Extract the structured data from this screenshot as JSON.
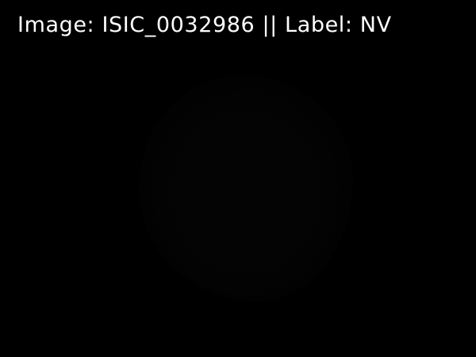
{
  "overlay": {
    "caption": "Image: ISIC_0032986 || Label: NV"
  },
  "colors": {
    "background": "#000000",
    "text": "#ffffff"
  }
}
